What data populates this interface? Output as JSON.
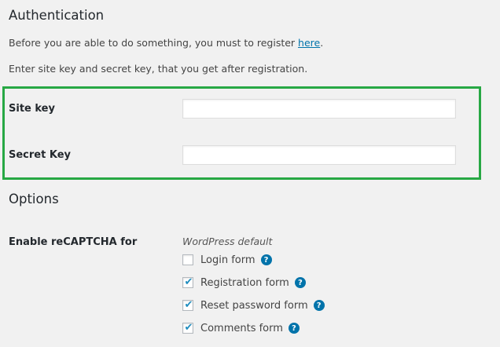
{
  "auth": {
    "title": "Authentication",
    "register_prefix": "Before you are able to do something, you must to register ",
    "register_link": "here",
    "register_suffix": ".",
    "instructions": "Enter site key and secret key, that you get after registration.",
    "site_key_label": "Site key",
    "site_key_value": "",
    "secret_key_label": "Secret Key",
    "secret_key_value": ""
  },
  "options": {
    "title": "Options",
    "enable_label": "Enable reCAPTCHA for",
    "group_label": "WordPress default",
    "items": [
      {
        "label": "Login form",
        "checked": false
      },
      {
        "label": "Registration form",
        "checked": true
      },
      {
        "label": "Reset password form",
        "checked": true
      },
      {
        "label": "Comments form",
        "checked": true
      }
    ]
  },
  "colors": {
    "highlight_border": "#27a844",
    "link": "#0073aa",
    "checkmark": "#1e8cbe"
  },
  "icons": {
    "help": "question-circle-icon",
    "check": "checkmark-icon"
  }
}
